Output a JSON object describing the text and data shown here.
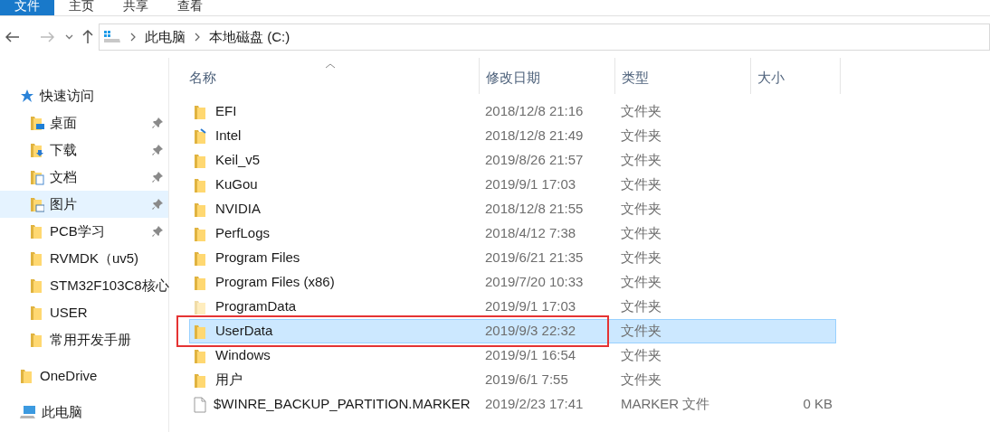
{
  "ribbon": {
    "tabs": [
      {
        "label": "文件",
        "selected": true
      },
      {
        "label": "主页",
        "selected": false
      },
      {
        "label": "共享",
        "selected": false
      },
      {
        "label": "查看",
        "selected": false
      }
    ]
  },
  "address_bar": {
    "breadcrumbs": [
      "此电脑",
      "本地磁盘 (C:)"
    ]
  },
  "sidebar": {
    "sections": [
      {
        "label": "快速访问",
        "kind": "star",
        "items": [
          {
            "label": "桌面",
            "kind": "desktop",
            "pinned": true,
            "selected": false
          },
          {
            "label": "下载",
            "kind": "download",
            "pinned": true,
            "selected": false
          },
          {
            "label": "文档",
            "kind": "documents",
            "pinned": true,
            "selected": false
          },
          {
            "label": "图片",
            "kind": "pictures",
            "pinned": true,
            "selected": true
          },
          {
            "label": "PCB学习",
            "kind": "folder",
            "pinned": true,
            "selected": false
          },
          {
            "label": "RVMDK（uv5)",
            "kind": "folder",
            "pinned": false,
            "selected": false
          },
          {
            "label": "STM32F103C8核心",
            "kind": "folder",
            "pinned": false,
            "selected": false
          },
          {
            "label": "USER",
            "kind": "folder",
            "pinned": false,
            "selected": false
          },
          {
            "label": "常用开发手册",
            "kind": "folder",
            "pinned": false,
            "selected": false
          }
        ]
      },
      {
        "label": "OneDrive",
        "kind": "folder"
      },
      {
        "label": "此电脑",
        "kind": "computer"
      }
    ]
  },
  "table": {
    "columns": [
      "名称",
      "修改日期",
      "类型",
      "大小"
    ],
    "rows": [
      {
        "name": "EFI",
        "date": "2018/12/8 21:16",
        "type": "文件夹",
        "kind": "folder",
        "selected": false,
        "outlined": false
      },
      {
        "name": "Intel",
        "date": "2018/12/8 21:49",
        "type": "文件夹",
        "kind": "linked-folder",
        "selected": false,
        "outlined": false
      },
      {
        "name": "Keil_v5",
        "date": "2019/8/26 21:57",
        "type": "文件夹",
        "kind": "folder",
        "selected": false,
        "outlined": false
      },
      {
        "name": "KuGou",
        "date": "2019/9/1 17:03",
        "type": "文件夹",
        "kind": "folder",
        "selected": false,
        "outlined": false
      },
      {
        "name": "NVIDIA",
        "date": "2018/12/8 21:55",
        "type": "文件夹",
        "kind": "folder",
        "selected": false,
        "outlined": false
      },
      {
        "name": "PerfLogs",
        "date": "2018/4/12 7:38",
        "type": "文件夹",
        "kind": "folder",
        "selected": false,
        "outlined": false
      },
      {
        "name": "Program Files",
        "date": "2019/6/21 21:35",
        "type": "文件夹",
        "kind": "folder",
        "selected": false,
        "outlined": false
      },
      {
        "name": "Program Files (x86)",
        "date": "2019/7/20 10:33",
        "type": "文件夹",
        "kind": "folder",
        "selected": false,
        "outlined": false
      },
      {
        "name": "ProgramData",
        "date": "2019/9/1 17:03",
        "type": "文件夹",
        "kind": "hidden-folder",
        "selected": false,
        "outlined": false
      },
      {
        "name": "UserData",
        "date": "2019/9/3 22:32",
        "type": "文件夹",
        "kind": "folder",
        "selected": true,
        "outlined": true
      },
      {
        "name": "Windows",
        "date": "2019/9/1 16:54",
        "type": "文件夹",
        "kind": "folder",
        "selected": false,
        "outlined": false
      },
      {
        "name": "用户",
        "date": "2019/6/1 7:55",
        "type": "文件夹",
        "kind": "folder",
        "selected": false,
        "outlined": false
      },
      {
        "name": "$WINRE_BACKUP_PARTITION.MARKER",
        "date": "2019/2/23 17:41",
        "type": "MARKER 文件",
        "size": "0 KB",
        "kind": "file",
        "selected": false,
        "outlined": false
      }
    ]
  }
}
